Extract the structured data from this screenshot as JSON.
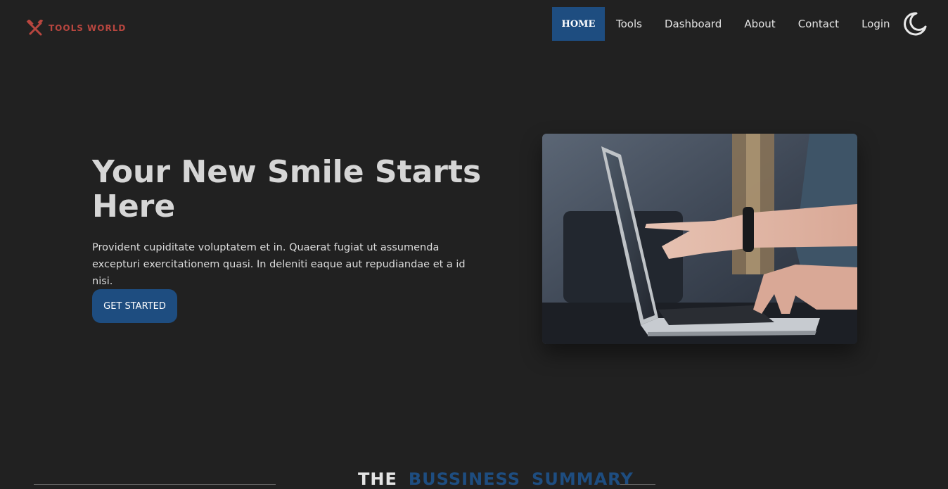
{
  "brand": {
    "name": "TOOLS WORLD",
    "icon": "crossed-tools-icon",
    "color": "#b8463f"
  },
  "nav": {
    "items": [
      {
        "label": "HOME",
        "active": true
      },
      {
        "label": "Tools"
      },
      {
        "label": "Dashboard"
      },
      {
        "label": "About"
      },
      {
        "label": "Contact"
      },
      {
        "label": "Login"
      }
    ],
    "theme_toggle_icon": "moon-icon",
    "active_color": "#1e4d80"
  },
  "hero": {
    "title": "Your New Smile Starts Here",
    "description": "Provident cupiditate voluptatem et in. Quaerat fugiat ut assumenda excepturi exercitationem quasi. In deleniti eaque aut repudiandae et a id nisi.",
    "cta_label": "GET STARTED",
    "image_subject": "laptop-photo"
  },
  "section": {
    "title_word_1": "THE",
    "title_word_2": "BUSSINESS",
    "title_word_3": "SUMMARY"
  },
  "colors": {
    "background": "#212121",
    "accent": "#1e4d80"
  }
}
